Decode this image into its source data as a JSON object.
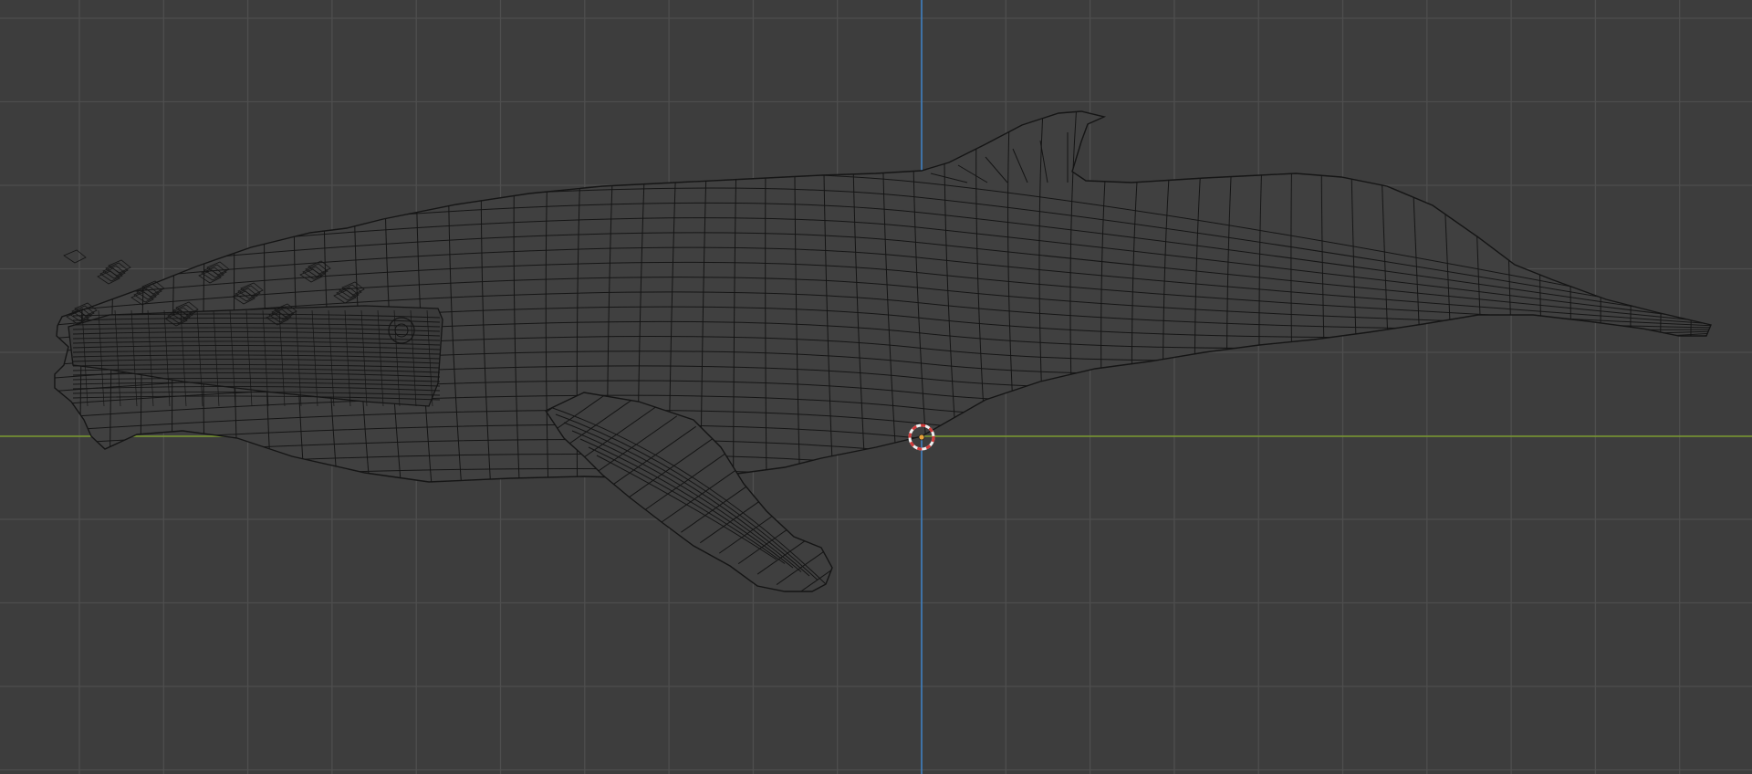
{
  "viewport": {
    "mode": "3d-viewport-wireframe",
    "object": "humpback-whale-mesh",
    "colors": {
      "background": "#3d3d3d",
      "grid": "#4e4e4e",
      "x_axis": "#7a9a2e",
      "z_axis": "#3f7fbf",
      "wire": "#151515",
      "mesh_fill": "#404040",
      "cursor_red": "#d23a3a",
      "cursor_white": "#f0f0f0"
    },
    "icons": {
      "cursor": "3d-cursor-icon",
      "origin": "object-origin-icon"
    }
  }
}
